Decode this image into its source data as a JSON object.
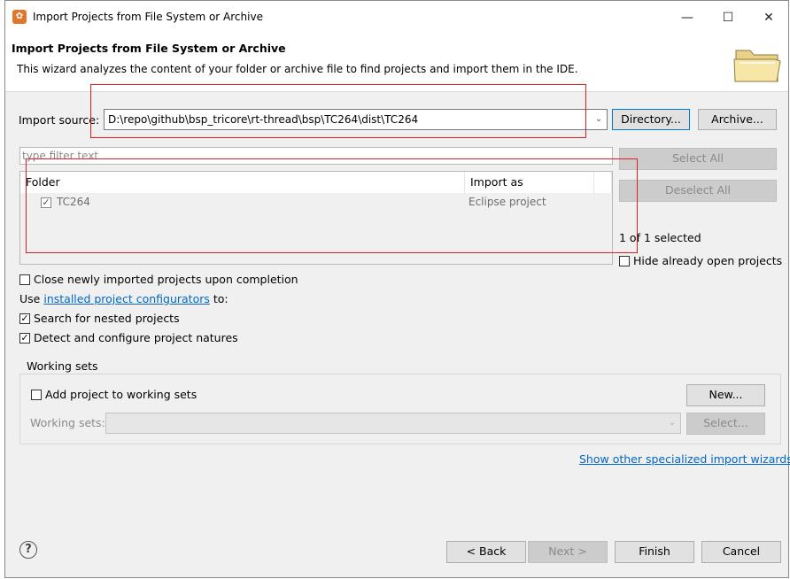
{
  "window": {
    "title": "Import Projects from File System or Archive",
    "controls": {
      "minimize": "—",
      "maximize": "☐",
      "close": "✕"
    }
  },
  "header": {
    "title": "Import Projects from File System or Archive",
    "description": "This wizard analyzes the content of your folder or archive file to find projects and import them in the IDE."
  },
  "import_source": {
    "label": "Import source:",
    "value": "D:\\repo\\github\\bsp_tricore\\rt-thread\\bsp\\TC264\\dist\\TC264",
    "directory_button": "Directory...",
    "archive_button": "Archive..."
  },
  "filter": {
    "placeholder": "type filter text"
  },
  "table": {
    "columns": [
      "Folder",
      "Import as"
    ],
    "rows": [
      {
        "folder": "TC264",
        "import_as": "Eclipse project",
        "checked": true
      }
    ]
  },
  "side_buttons": {
    "select_all": "Select All",
    "deselect_all": "Deselect All",
    "selection_count": "1 of 1 selected",
    "hide_open_label": "Hide already open projects"
  },
  "options": {
    "close_after": "Close newly imported projects upon completion",
    "use_prefix": "Use",
    "use_link": "installed project configurators",
    "use_suffix": "to:",
    "search_nested": "Search for nested projects",
    "detect_natures": "Detect and configure project natures"
  },
  "working_sets": {
    "group_label": "Working sets",
    "add_label": "Add project to working sets",
    "new_button": "New...",
    "sets_label": "Working sets:",
    "select_button": "Select..."
  },
  "show_other_link": "Show other specialized import wizards",
  "footer": {
    "help_icon": "?",
    "back": "< Back",
    "next": "Next >",
    "finish": "Finish",
    "cancel": "Cancel"
  },
  "colors": {
    "annotation_red": "#e02020",
    "link_blue": "#0066cc",
    "dialog_bg": "#f0f0f0"
  }
}
